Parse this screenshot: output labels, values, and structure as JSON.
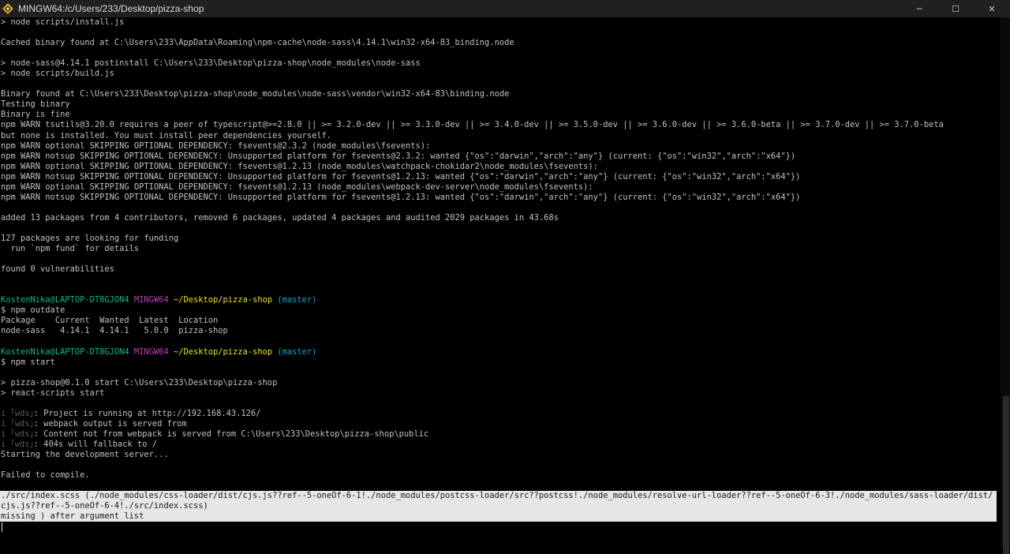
{
  "window": {
    "title": "MINGW64:/c/Users/233/Desktop/pizza-shop",
    "controls": {
      "minimize": "─",
      "maximize": "☐",
      "close": "✕"
    }
  },
  "colors": {
    "user_host": "#0dbc79",
    "shell": "#bc3fbc",
    "path": "#e5e510",
    "branch": "#11a8cd",
    "error_bg": "#e6e6e6"
  },
  "terminal": {
    "lines": [
      "> node scripts/install.js",
      "",
      "Cached binary found at C:\\Users\\233\\AppData\\Roaming\\npm-cache\\node-sass\\4.14.1\\win32-x64-83_binding.node",
      "",
      "> node-sass@4.14.1 postinstall C:\\Users\\233\\Desktop\\pizza-shop\\node_modules\\node-sass",
      "> node scripts/build.js",
      "",
      "Binary found at C:\\Users\\233\\Desktop\\pizza-shop\\node_modules\\node-sass\\vendor\\win32-x64-83\\binding.node",
      "Testing binary",
      "Binary is fine",
      "npm WARN tsutils@3.20.0 requires a peer of typescript@>=2.8.0 || >= 3.2.0-dev || >= 3.3.0-dev || >= 3.4.0-dev || >= 3.5.0-dev || >= 3.6.0-dev || >= 3.6.0-beta || >= 3.7.0-dev || >= 3.7.0-beta",
      "but none is installed. You must install peer dependencies yourself.",
      "npm WARN optional SKIPPING OPTIONAL DEPENDENCY: fsevents@2.3.2 (node_modules\\fsevents):",
      "npm WARN notsup SKIPPING OPTIONAL DEPENDENCY: Unsupported platform for fsevents@2.3.2: wanted {\"os\":\"darwin\",\"arch\":\"any\"} (current: {\"os\":\"win32\",\"arch\":\"x64\"})",
      "npm WARN optional SKIPPING OPTIONAL DEPENDENCY: fsevents@1.2.13 (node_modules\\watchpack-chokidar2\\node_modules\\fsevents):",
      "npm WARN notsup SKIPPING OPTIONAL DEPENDENCY: Unsupported platform for fsevents@1.2.13: wanted {\"os\":\"darwin\",\"arch\":\"any\"} (current: {\"os\":\"win32\",\"arch\":\"x64\"})",
      "npm WARN optional SKIPPING OPTIONAL DEPENDENCY: fsevents@1.2.13 (node_modules\\webpack-dev-server\\node_modules\\fsevents):",
      "npm WARN notsup SKIPPING OPTIONAL DEPENDENCY: Unsupported platform for fsevents@1.2.13: wanted {\"os\":\"darwin\",\"arch\":\"any\"} (current: {\"os\":\"win32\",\"arch\":\"x64\"})",
      "",
      "added 13 packages from 4 contributors, removed 6 packages, updated 4 packages and audited 2029 packages in 43.68s",
      "",
      "127 packages are looking for funding",
      "  run `npm fund` for details",
      "",
      "found 0 vulnerabilities",
      "",
      "",
      {
        "prompt": {
          "user": "KostenNika@LAPTOP-DT8GJON4",
          "shell": "MINGW64",
          "path": "~/Desktop/pizza-shop",
          "branch": "(master)"
        }
      },
      "$ npm outdate",
      "Package    Current  Wanted  Latest  Location",
      "node-sass   4.14.1  4.14.1   5.0.0  pizza-shop",
      "",
      {
        "prompt": {
          "user": "KostenNika@LAPTOP-DT8GJON4",
          "shell": "MINGW64",
          "path": "~/Desktop/pizza-shop",
          "branch": "(master)"
        }
      },
      "$ npm start",
      "",
      "> pizza-shop@0.1.0 start C:\\Users\\233\\Desktop\\pizza-shop",
      "> react-scripts start",
      "",
      {
        "dim": "i ｢wds｣",
        "text": ": Project is running at http://192.168.43.126/"
      },
      {
        "dim": "i ｢wds｣",
        "text": ": webpack output is served from"
      },
      {
        "dim": "i ｢wds｣",
        "text": ": Content not from webpack is served from C:\\Users\\233\\Desktop\\pizza-shop\\public"
      },
      {
        "dim": "i ｢wds｣",
        "text": ": 404s will fallback to /"
      },
      "Starting the development server...",
      "",
      "Failed to compile.",
      ""
    ],
    "error_lines": [
      "./src/index.scss (./node_modules/css-loader/dist/cjs.js??ref--5-oneOf-6-1!./node_modules/postcss-loader/src??postcss!./node_modules/resolve-url-loader??ref--5-oneOf-6-3!./node_modules/sass-loader/dist/cjs.js??ref--5-oneOf-6-4!./src/index.scss)",
      "missing ) after argument list"
    ]
  }
}
